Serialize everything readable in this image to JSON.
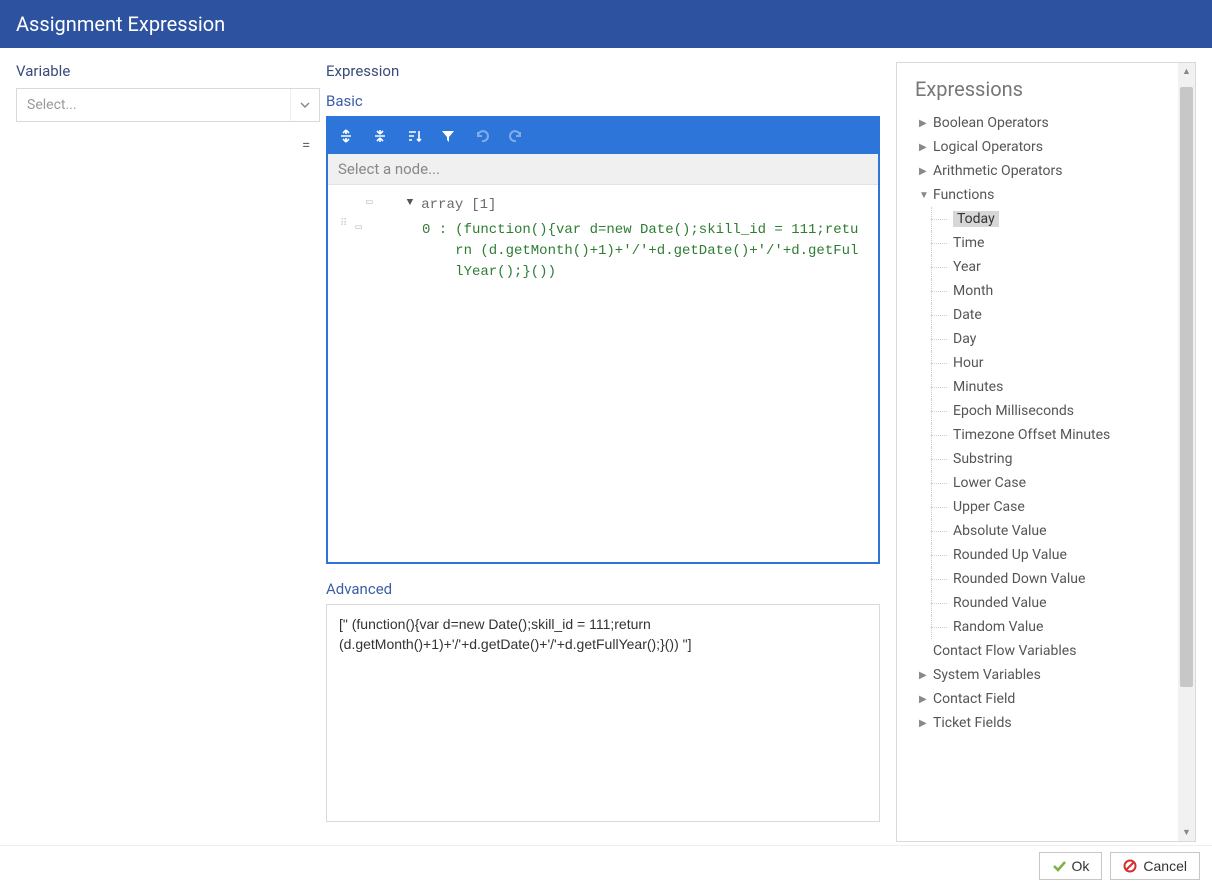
{
  "title": "Assignment Expression",
  "left": {
    "variable_label": "Variable",
    "variable_placeholder": "Select..."
  },
  "equals": "=",
  "mid": {
    "expression_label": "Expression",
    "basic_label": "Basic",
    "node_placeholder": "Select a node...",
    "tree": {
      "array_kw": "array",
      "array_count": "[1]",
      "index_label": "0 :",
      "value": "(function(){var d=new Date();skill_id = 111;return (d.getMonth()+1)+'/'+d.getDate()+'/'+d.getFullYear();}())"
    },
    "advanced_label": "Advanced",
    "advanced_text": "[\" (function(){var d=new Date();skill_id = 111;return (d.getMonth()+1)+'/'+d.getDate()+'/'+d.getFullYear();}()) \"]"
  },
  "right": {
    "title": "Expressions",
    "groups": [
      {
        "label": "Boolean Operators",
        "expanded": false
      },
      {
        "label": "Logical Operators",
        "expanded": false
      },
      {
        "label": "Arithmetic Operators",
        "expanded": false
      },
      {
        "label": "Functions",
        "expanded": true,
        "children": [
          {
            "label": "Today",
            "selected": true
          },
          {
            "label": "Time"
          },
          {
            "label": "Year"
          },
          {
            "label": "Month"
          },
          {
            "label": "Date"
          },
          {
            "label": "Day"
          },
          {
            "label": "Hour"
          },
          {
            "label": "Minutes"
          },
          {
            "label": "Epoch Milliseconds"
          },
          {
            "label": "Timezone Offset Minutes"
          },
          {
            "label": "Substring"
          },
          {
            "label": "Lower Case"
          },
          {
            "label": "Upper Case"
          },
          {
            "label": "Absolute Value"
          },
          {
            "label": "Rounded Up Value"
          },
          {
            "label": "Rounded Down Value"
          },
          {
            "label": "Rounded Value"
          },
          {
            "label": "Random Value"
          }
        ]
      },
      {
        "label": "Contact Flow Variables",
        "expanded": false,
        "noCaret": true
      },
      {
        "label": "System Variables",
        "expanded": false
      },
      {
        "label": "Contact Field",
        "expanded": false
      },
      {
        "label": "Ticket Fields",
        "expanded": false
      }
    ]
  },
  "footer": {
    "ok": "Ok",
    "cancel": "Cancel"
  }
}
